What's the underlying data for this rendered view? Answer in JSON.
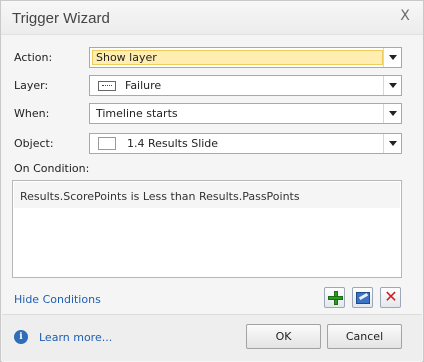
{
  "window": {
    "title": "Trigger Wizard",
    "close_glyph": "X"
  },
  "form": {
    "action": {
      "label": "Action:",
      "value": "Show layer"
    },
    "layer": {
      "label": "Layer:",
      "value": "Failure",
      "icon": "layer-icon"
    },
    "when": {
      "label": "When:",
      "value": "Timeline starts"
    },
    "object": {
      "label": "Object:",
      "value": "1.4 Results Slide",
      "icon": "slide-thumbnail-icon"
    }
  },
  "conditions": {
    "label": "On Condition:",
    "items": [
      "Results.ScorePoints is Less than Results.PassPoints"
    ],
    "toggle_link": "Hide Conditions",
    "buttons": {
      "add": "add-condition-icon",
      "edit": "edit-condition-icon",
      "delete": "delete-condition-icon"
    }
  },
  "footer": {
    "learn_more": "Learn more...",
    "ok_label": "OK",
    "cancel_label": "Cancel"
  },
  "colors": {
    "link": "#1f5fb0",
    "highlight_fill": "#ffeeb0",
    "add_green": "#2d9a22",
    "delete_red": "#d21d1d",
    "edit_blue": "#3b73c4"
  }
}
